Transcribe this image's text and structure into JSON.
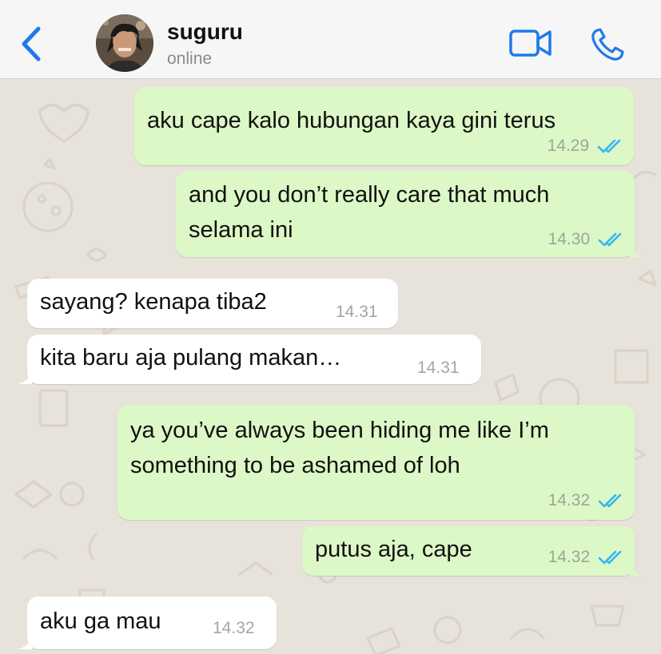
{
  "header": {
    "contact_name": "suguru",
    "status": "online",
    "back_icon": "chevron-left-icon",
    "video_icon": "video-camera-icon",
    "call_icon": "phone-icon",
    "accent_color": "#1f7ae8"
  },
  "messages": [
    {
      "direction": "outgoing",
      "text": "aku cape kalo hubungan kaya gini terus",
      "time": "14.29",
      "status": "read"
    },
    {
      "direction": "outgoing",
      "text": "and you don’t really care that much\nselama ini",
      "time": "14.30",
      "status": "read"
    },
    {
      "direction": "incoming",
      "text": "sayang? kenapa tiba2",
      "time": "14.31"
    },
    {
      "direction": "incoming",
      "text": "kita baru aja pulang makan…",
      "time": "14.31"
    },
    {
      "direction": "outgoing",
      "text": "ya you’ve always been hiding me like I’m\nsomething to be ashamed of loh",
      "time": "14.32",
      "status": "read"
    },
    {
      "direction": "outgoing",
      "text": "putus aja, cape",
      "time": "14.32",
      "status": "read"
    },
    {
      "direction": "incoming",
      "text": "aku ga mau",
      "time": "14.32"
    }
  ],
  "colors": {
    "outgoing_bubble": "#dcf8c6",
    "incoming_bubble": "#ffffff",
    "read_tick": "#34b7f1",
    "chat_background": "#e7e2da"
  }
}
